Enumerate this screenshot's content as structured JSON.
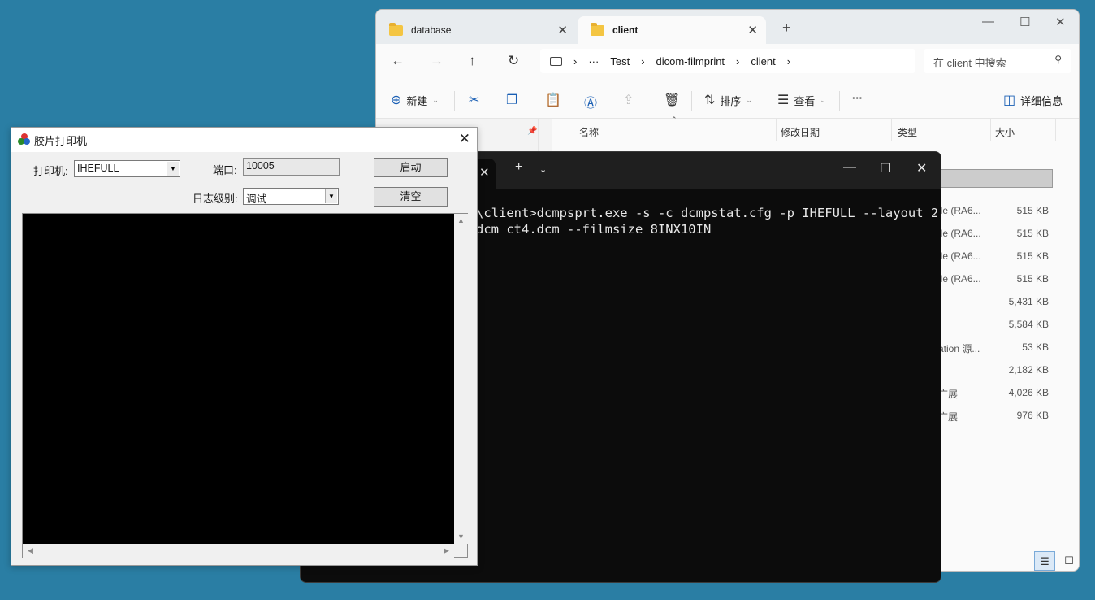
{
  "explorer": {
    "tabs": [
      {
        "label": "database"
      },
      {
        "label": "client"
      }
    ],
    "breadcrumb": [
      "Test",
      "dicom-filmprint",
      "client"
    ],
    "breadcrumb_more": "···",
    "search_placeholder": "在 client 中搜索",
    "toolbar": {
      "new_label": "新建",
      "sort_label": "排序",
      "view_label": "查看",
      "more_label": "···",
      "details_label": "详细信息"
    },
    "columns": {
      "name": "名称",
      "modified": "修改日期",
      "type": "类型",
      "size": "大小"
    },
    "rows": [
      {
        "type": "ile (RA6...",
        "size": "515 KB"
      },
      {
        "type": "ile (RA6...",
        "size": "515 KB"
      },
      {
        "type": "ile (RA6...",
        "size": "515 KB"
      },
      {
        "type": "ile (RA6...",
        "size": "515 KB"
      },
      {
        "type": "",
        "size": "5,431 KB"
      },
      {
        "type": "",
        "size": "5,584 KB"
      },
      {
        "type": "ation 源...",
        "size": "53 KB"
      },
      {
        "type": "",
        "size": "2,182 KB"
      },
      {
        "type": "广展",
        "size": "4,026 KB"
      },
      {
        "type": "广展",
        "size": "976 KB"
      }
    ]
  },
  "terminal": {
    "lines": [
      "\\client>dcmpsprt.exe -s -c dcmpstat.cfg -p IHEFULL --layout 2",
      "dcm ct4.dcm --filmsize 8INX10IN"
    ]
  },
  "dialog": {
    "title": "胶片打印机",
    "printer_label": "打印机:",
    "printer_value": "IHEFULL",
    "port_label": "端口:",
    "port_value": "10005",
    "loglevel_label": "日志级别:",
    "loglevel_value": "调试",
    "start_button": "启动",
    "clear_button": "清空"
  }
}
